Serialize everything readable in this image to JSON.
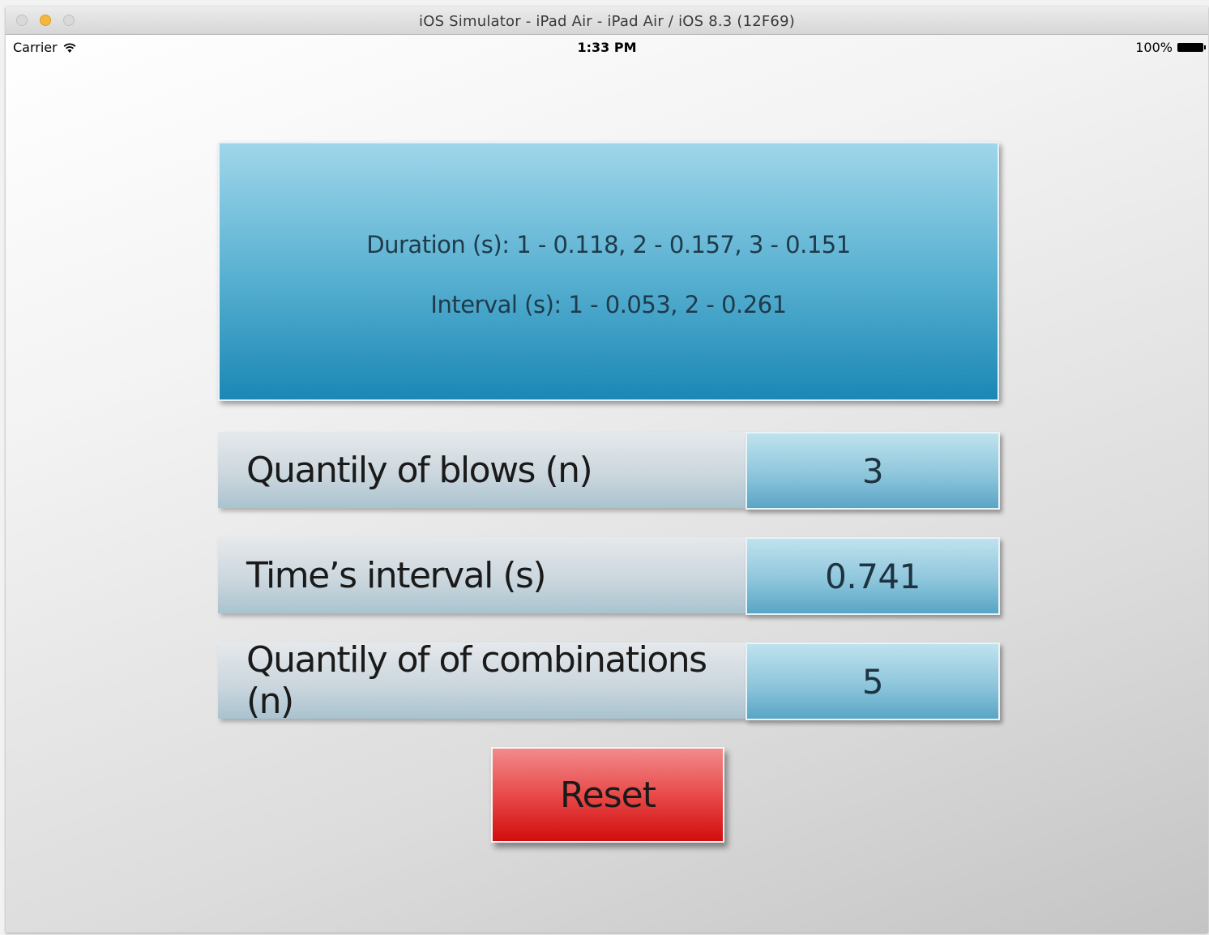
{
  "window": {
    "title": "iOS Simulator - iPad Air - iPad Air / iOS 8.3 (12F69)"
  },
  "statusbar": {
    "carrier": "Carrier",
    "time": "1:33 PM",
    "battery": "100%"
  },
  "info": {
    "duration": "Duration (s): 1 - 0.118, 2 - 0.157, 3 - 0.151",
    "interval": "Interval (s): 1 - 0.053, 2 - 0.261"
  },
  "rows": [
    {
      "label": "Quantily of blows (n)",
      "value": "3"
    },
    {
      "label": "Time’s interval (s)",
      "value": "0.741"
    },
    {
      "label": "Quantily of of combinations (n)",
      "value": "5"
    }
  ],
  "reset_label": "Reset",
  "colors": {
    "panel_top": "#9fd6ea",
    "panel_bottom": "#1b87b5",
    "reset_top": "#f28b8b",
    "reset_bottom": "#d20d0d"
  },
  "icons": [
    "wifi-icon",
    "battery-icon"
  ]
}
